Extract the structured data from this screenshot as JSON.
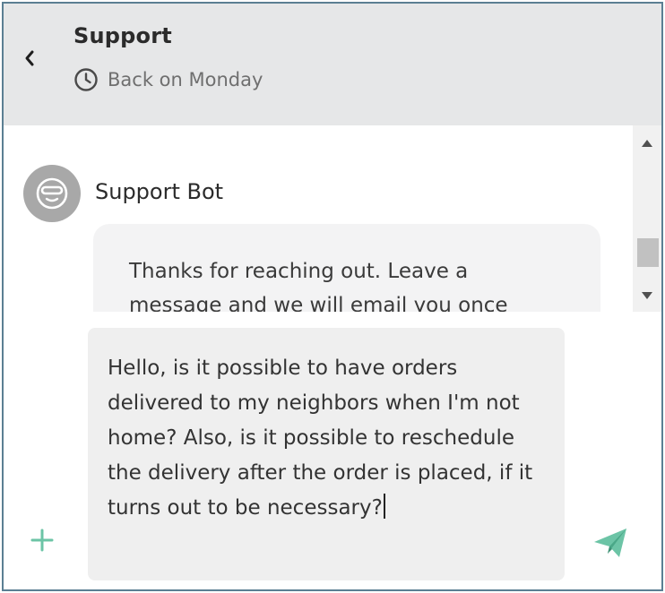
{
  "header": {
    "title": "Support",
    "status": "Back on Monday"
  },
  "icons": {
    "back": "chevron-left-icon",
    "status": "clock-icon",
    "bot_avatar": "bot-face-icon",
    "scroll_up": "triangle-up-icon",
    "scroll_down": "triangle-down-icon",
    "add": "plus-icon",
    "send": "send-plane-icon"
  },
  "conversation": {
    "bot_name": "Support Bot",
    "bot_message": "Thanks for reaching out. Leave a message and we will email you once"
  },
  "composer": {
    "value": "Hello, is it possible to have orders delivered to my neighbors when I'm not home? Also, is it possible to reschedule the delivery after the order is placed, if it turns out to be necessary?"
  },
  "colors": {
    "header_bg": "#e6e7e8",
    "border": "#5b7f93",
    "accent": "#6cc4a6",
    "avatar_bg": "#a8a8a8",
    "bubble_bg": "#f3f3f4",
    "input_bg": "#efefef"
  }
}
